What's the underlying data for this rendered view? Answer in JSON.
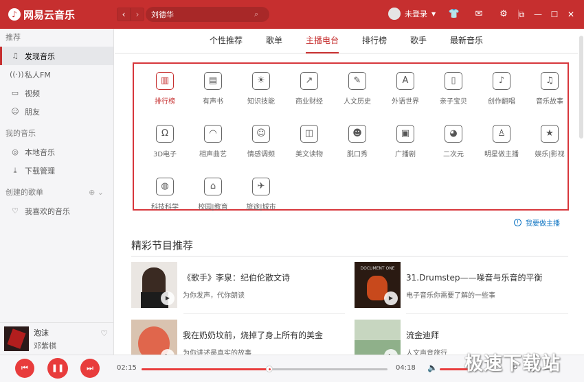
{
  "app": {
    "name": "网易云音乐",
    "logo_icon": "netease-cloud-music-logo-icon",
    "accent": "#c62f2f"
  },
  "header": {
    "back_icon": "chevron-left-icon",
    "forward_icon": "chevron-right-icon",
    "search_value": "刘德华",
    "user_label": "未登录",
    "icons": [
      "skin-icon",
      "mail-icon",
      "gear-icon"
    ],
    "window_icons": [
      "mini-mode-icon",
      "minimize-icon",
      "maximize-icon",
      "close-icon"
    ]
  },
  "sidebar": {
    "recommend_title": "推荐",
    "recommend_items": [
      {
        "label": "发现音乐",
        "icon": "music-note-icon",
        "active": true
      },
      {
        "label": "私人FM",
        "icon": "radio-waves-icon",
        "active": false
      },
      {
        "label": "视频",
        "icon": "video-icon",
        "active": false
      },
      {
        "label": "朋友",
        "icon": "friends-icon",
        "active": false
      }
    ],
    "my_music_title": "我的音乐",
    "my_music_items": [
      {
        "label": "本地音乐",
        "icon": "local-music-icon"
      },
      {
        "label": "下载管理",
        "icon": "download-icon"
      }
    ],
    "playlists_title": "创建的歌单",
    "playlist_items": [
      {
        "label": "我喜欢的音乐",
        "icon": "heart-icon"
      }
    ]
  },
  "now_playing": {
    "title": "泡沫",
    "artist": "邓紫棋"
  },
  "tabs": [
    {
      "label": "个性推荐",
      "active": false
    },
    {
      "label": "歌单",
      "active": false
    },
    {
      "label": "主播电台",
      "active": true
    },
    {
      "label": "排行榜",
      "active": false
    },
    {
      "label": "歌手",
      "active": false
    },
    {
      "label": "最新音乐",
      "active": false
    }
  ],
  "categories": [
    {
      "label": "排行榜",
      "icon": "bar-chart-icon",
      "active": true
    },
    {
      "label": "有声书",
      "icon": "book-icon"
    },
    {
      "label": "知识技能",
      "icon": "lightbulb-icon"
    },
    {
      "label": "商业财经",
      "icon": "trend-chart-icon"
    },
    {
      "label": "人文历史",
      "icon": "quill-pen-icon"
    },
    {
      "label": "外语世界",
      "icon": "abc-blocks-icon"
    },
    {
      "label": "亲子宝贝",
      "icon": "milk-bottle-icon"
    },
    {
      "label": "创作翻唱",
      "icon": "microphone-icon"
    },
    {
      "label": "音乐故事",
      "icon": "music-notes-icon"
    },
    {
      "label": "3D电子",
      "icon": "headphones-icon"
    },
    {
      "label": "相声曲艺",
      "icon": "fan-icon"
    },
    {
      "label": "情感调频",
      "icon": "smile-face-icon"
    },
    {
      "label": "美文读物",
      "icon": "open-book-icon"
    },
    {
      "label": "脱口秀",
      "icon": "mask-icon"
    },
    {
      "label": "广播剧",
      "icon": "radio-icon"
    },
    {
      "label": "二次元",
      "icon": "cartoon-face-icon"
    },
    {
      "label": "明星做主播",
      "icon": "person-icon"
    },
    {
      "label": "娱乐|影视",
      "icon": "star-icon"
    },
    {
      "label": "科技科学",
      "icon": "planet-icon"
    },
    {
      "label": "校园|教育",
      "icon": "graduation-cap-icon"
    },
    {
      "label": "旅途|城市",
      "icon": "airplane-icon"
    }
  ],
  "apply_link": "我要做主播",
  "section_title": "精彩节目推荐",
  "programs": [
    {
      "title": "《歌手》李泉：纪伯伦散文诗",
      "subtitle": "为你发声，代你朗读",
      "thumb_color": "#eae6e2"
    },
    {
      "title": "31.Drumstep——噪音与乐音的平衡",
      "subtitle": "电子音乐你需要了解的一些事",
      "thumb_color": "#2a1a12"
    },
    {
      "title": "我在奶奶坟前，烧掉了身上所有的美金",
      "subtitle": "为你讲述最真实的故事",
      "thumb_color": "#d9c3b0"
    },
    {
      "title": "流金迪拜",
      "subtitle": "人文声音旅行",
      "thumb_color": "#c7d6c0"
    }
  ],
  "player": {
    "current_time": "02:15",
    "total_time": "04:18",
    "progress": 0.52,
    "volume": 1.0,
    "prev_icon": "prev-icon",
    "pause_icon": "pause-icon",
    "next_icon": "next-icon",
    "volume_icon": "volume-icon",
    "mode_icons": [
      "loop-icon",
      "lyrics-icon",
      "playlist-icon"
    ]
  },
  "watermark": "极速下载站"
}
